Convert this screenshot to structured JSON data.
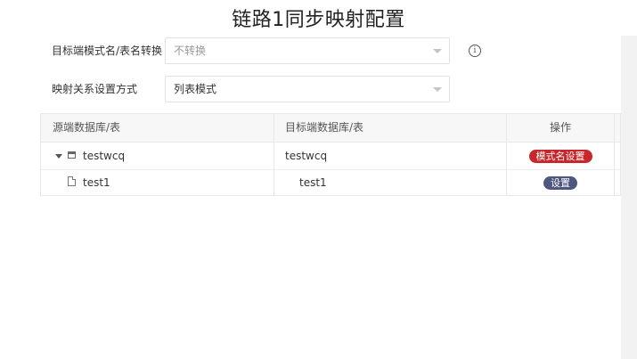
{
  "page": {
    "title": "链路1同步映射配置"
  },
  "form": {
    "schema_convert": {
      "label": "目标端模式名/表名转换",
      "value": "不转换"
    },
    "mapping_mode": {
      "label": "映射关系设置方式",
      "value": "列表模式"
    }
  },
  "table": {
    "headers": {
      "source": "源端数据库/表",
      "target": "目标端数据库/表",
      "ops": "操作"
    },
    "rows": [
      {
        "source": "testwcq",
        "target": "testwcq",
        "action": "模式名设置",
        "type": "database"
      },
      {
        "source": "test1",
        "target": "test1",
        "action": "设置",
        "type": "table"
      }
    ]
  },
  "colors": {
    "danger_tag": "#c7272a",
    "slate_tag": "#4f5680"
  },
  "icons": [
    "info-icon",
    "caret-down-icon",
    "database-icon",
    "file-icon",
    "expand-triangle-icon"
  ]
}
